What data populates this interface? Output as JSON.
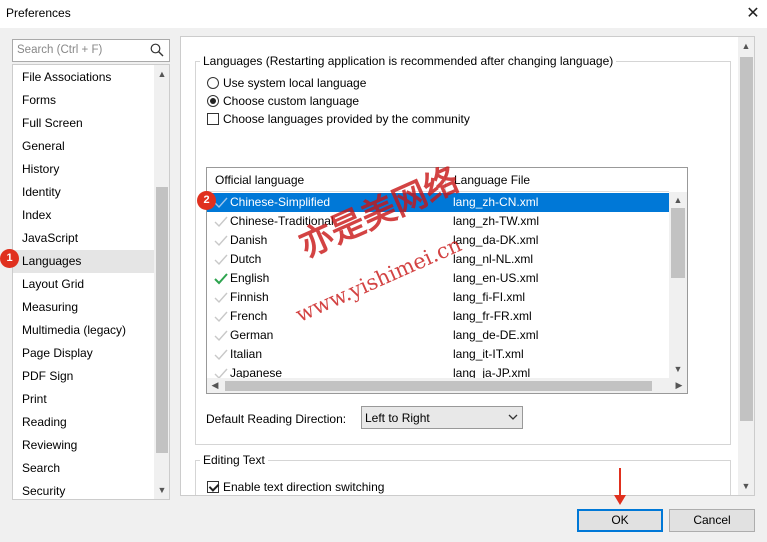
{
  "window": {
    "title": "Preferences"
  },
  "search": {
    "placeholder": "Search (Ctrl + F)"
  },
  "categories": [
    "File Associations",
    "Forms",
    "Full Screen",
    "General",
    "History",
    "Identity",
    "Index",
    "JavaScript",
    "Languages",
    "Layout Grid",
    "Measuring",
    "Multimedia (legacy)",
    "Page Display",
    "PDF Sign",
    "Print",
    "Reading",
    "Reviewing",
    "Search",
    "Security"
  ],
  "selected_category": "Languages",
  "languages": {
    "legend": "Languages (Restarting application is recommended after changing language)",
    "opt_system": "Use system local language",
    "opt_custom": "Choose custom language",
    "opt_community": "Choose languages provided by the community",
    "col_official": "Official language",
    "col_file": "Language File",
    "rows": [
      {
        "name": "Chinese-Simplified",
        "file": "lang_zh-CN.xml",
        "selected": true,
        "installed": false
      },
      {
        "name": "Chinese-Traditional",
        "file": "lang_zh-TW.xml",
        "selected": false,
        "installed": false
      },
      {
        "name": "Danish",
        "file": "lang_da-DK.xml",
        "selected": false,
        "installed": false
      },
      {
        "name": "Dutch",
        "file": "lang_nl-NL.xml",
        "selected": false,
        "installed": false
      },
      {
        "name": "English",
        "file": "lang_en-US.xml",
        "selected": false,
        "installed": true
      },
      {
        "name": "Finnish",
        "file": "lang_fi-FI.xml",
        "selected": false,
        "installed": false
      },
      {
        "name": "French",
        "file": "lang_fr-FR.xml",
        "selected": false,
        "installed": false
      },
      {
        "name": "German",
        "file": "lang_de-DE.xml",
        "selected": false,
        "installed": false
      },
      {
        "name": "Italian",
        "file": "lang_it-IT.xml",
        "selected": false,
        "installed": false
      },
      {
        "name": "Japanese",
        "file": "lang_ja-JP.xml",
        "selected": false,
        "installed": false
      }
    ],
    "reading_dir_label": "Default Reading Direction:",
    "reading_dir_value": "Left to Right"
  },
  "editing": {
    "legend": "Editing Text",
    "direction_switch": "Enable text direction switching"
  },
  "buttons": {
    "ok": "OK",
    "cancel": "Cancel"
  },
  "annotations": {
    "badge1": "1",
    "badge2": "2",
    "watermark_cn": "亦是美网络",
    "watermark_url": "www.yishimei.cn"
  },
  "colors": {
    "selection": "#0078d7",
    "check_green": "#2ea44f",
    "badge_red": "#e0301e"
  }
}
